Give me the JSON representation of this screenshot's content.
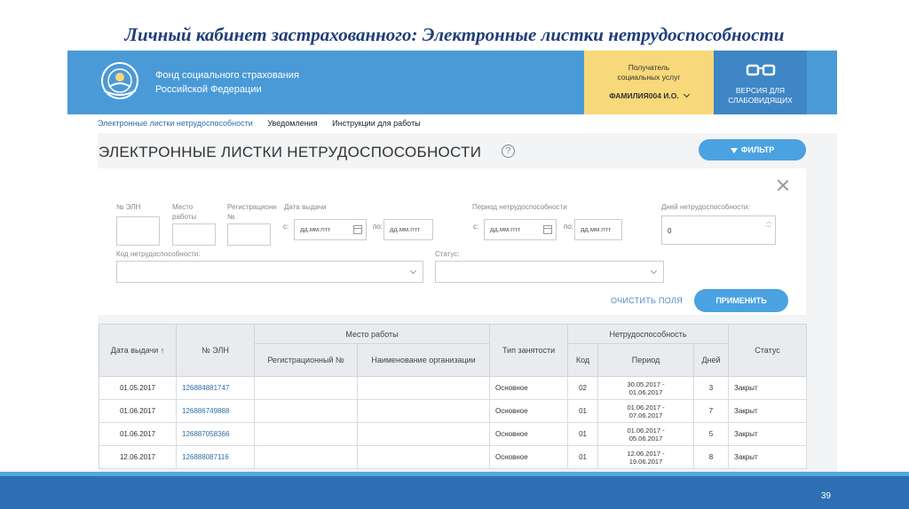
{
  "slide": {
    "title": "Личный кабинет застрахованного: Электронные листки нетрудоспособности",
    "page_number": "39"
  },
  "header": {
    "org_line1": "Фонд социального страхования",
    "org_line2": "Российской Федерации",
    "user_caption_line1": "Получатель",
    "user_caption_line2": "социальных услуг",
    "user_name": "ФАМИЛИЯ004 И.О.",
    "vision_line1": "ВЕРСИЯ ДЛЯ",
    "vision_line2": "СЛАБОВИДЯЩИХ"
  },
  "nav": {
    "items": [
      "Электронные листки нетрудоспособности",
      "Уведомления",
      "Инструкции для работы"
    ]
  },
  "main": {
    "title": "ЭЛЕКТРОННЫЕ ЛИСТКИ НЕТРУДОСПОСОБНОСТИ",
    "help_glyph": "?",
    "filter_label": "ФИЛЬТР"
  },
  "filter": {
    "eln_label": "№ ЭЛН",
    "workplace_label_1": "Место",
    "workplace_label_2": "работы",
    "reg_label_1": "Регистрационн",
    "reg_label_2": "№",
    "issue_date_label": "Дата выдачи",
    "from_label": "с:",
    "to_label": "по:",
    "date_placeholder": "дд.мм.гггг",
    "period_label": "Период нетрудоспособности",
    "days_label": "Дней нетрудоспособности:",
    "days_value": "0",
    "code_label": "Код нетрудоспособности:",
    "status_label": "Статус:",
    "clear_label": "ОЧИСТИТЬ ПОЛЯ",
    "apply_label": "ПРИМЕНИТЬ"
  },
  "table": {
    "headers": {
      "date": "Дата выдачи ↑",
      "eln": "№ ЭЛН",
      "workplace": "Место работы",
      "reg_num": "Регистрационный №",
      "org_name": "Наименование организации",
      "employment": "Тип занятости",
      "disability": "Нетрудоспособность",
      "code": "Код",
      "period": "Период",
      "days": "Дней",
      "status": "Статус"
    },
    "rows": [
      {
        "date": "01.05.2017",
        "eln": "126884881747",
        "employment": "Основное",
        "code": "02",
        "period_from": "30.05.2017 -",
        "period_to": "01.06.2017",
        "days": "3",
        "status": "Закрыт"
      },
      {
        "date": "01.06.2017",
        "eln": "126886749888",
        "employment": "Основное",
        "code": "01",
        "period_from": "01.06.2017 -",
        "period_to": "07.06.2017",
        "days": "7",
        "status": "Закрыт"
      },
      {
        "date": "01.06.2017",
        "eln": "126887058366",
        "employment": "Основное",
        "code": "01",
        "period_from": "01.06.2017 -",
        "period_to": "05.06.2017",
        "days": "5",
        "status": "Закрыт"
      },
      {
        "date": "12.06.2017",
        "eln": "126888087116",
        "employment": "Основное",
        "code": "01",
        "period_from": "12.06.2017 -",
        "period_to": "19.06.2017",
        "days": "8",
        "status": "Закрыт"
      }
    ]
  }
}
